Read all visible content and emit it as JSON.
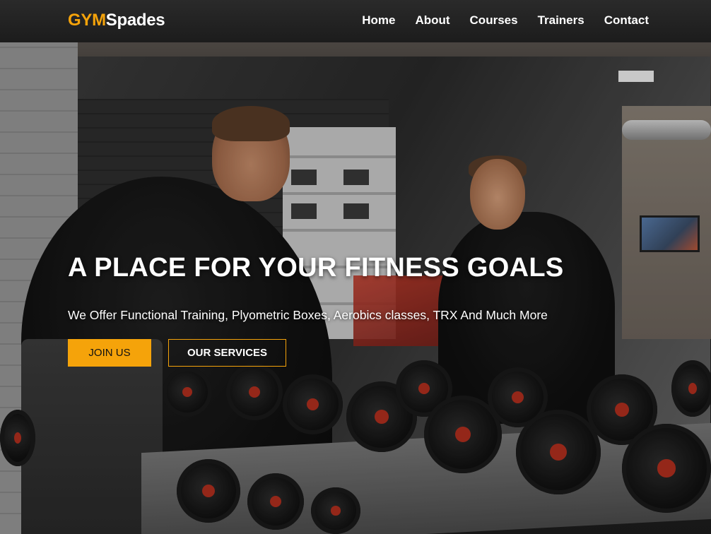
{
  "brand": {
    "part1": "GYM",
    "part2": "Spades"
  },
  "nav": {
    "items": [
      "Home",
      "About",
      "Courses",
      "Trainers",
      "Contact"
    ]
  },
  "hero": {
    "title": "A PLACE FOR YOUR FITNESS GOALS",
    "subtitle": "We Offer Functional Training, Plyometric Boxes, Aerobics classes, TRX And Much More",
    "primary_button": "JOIN US",
    "secondary_button": "OUR SERVICES"
  },
  "colors": {
    "accent": "#f5a30a",
    "navbar": "#1f1f1f",
    "text": "#ffffff"
  }
}
